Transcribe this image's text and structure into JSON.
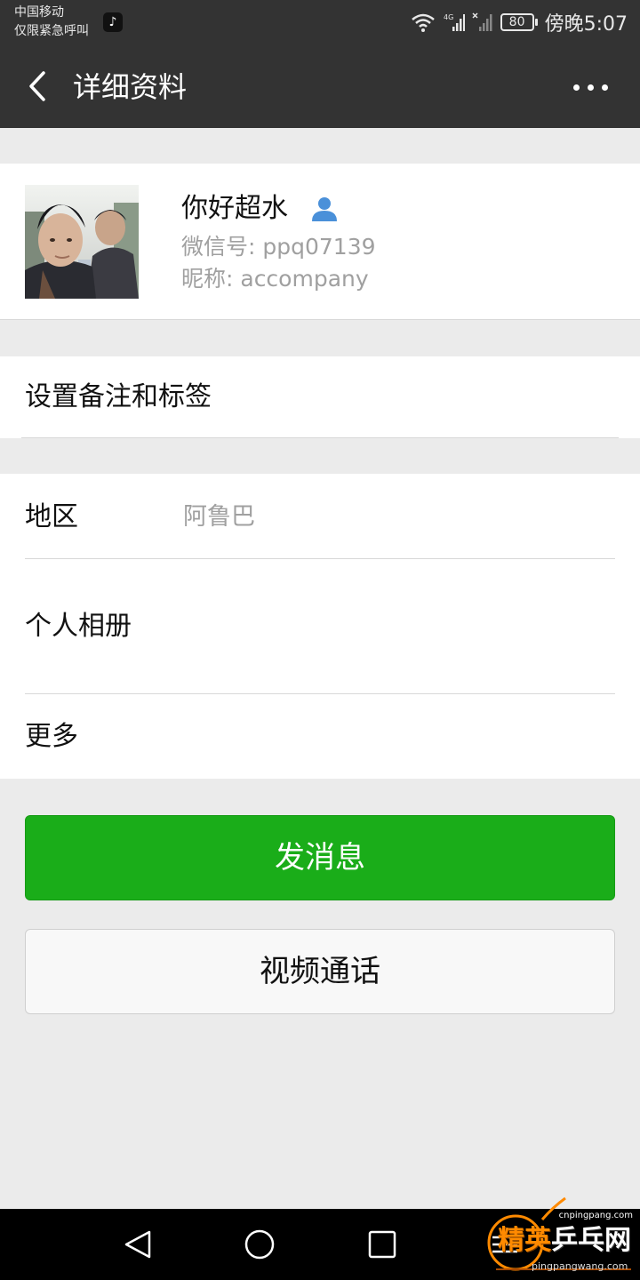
{
  "status_bar": {
    "carrier_line1": "中国移动",
    "carrier_line2": "仅限紧急呼叫",
    "network_type": "4G",
    "battery_level": "80",
    "time": "傍晚5:07"
  },
  "header": {
    "title": "详细资料"
  },
  "profile": {
    "name": "你好超水",
    "wechat_id": "微信号: ppq07139",
    "nickname": "昵称: accompany"
  },
  "remark_row": {
    "label": "设置备注和标签"
  },
  "info": {
    "region_label": "地区",
    "region_value": "阿鲁巴",
    "album_label": "个人相册",
    "more_label": "更多"
  },
  "actions": {
    "send_message": "发消息",
    "video_call": "视频通话"
  },
  "watermark": {
    "url_top": "cnpingpang.com",
    "brand_a": "精英",
    "brand_b": "乒乓网",
    "url_bottom": "pingpangwang.com"
  },
  "colors": {
    "header_bg": "#333333",
    "page_bg": "#ebebeb",
    "primary_green": "#1aad19",
    "secondary_text": "#a0a0a0",
    "contact_icon": "#4a90d9"
  }
}
